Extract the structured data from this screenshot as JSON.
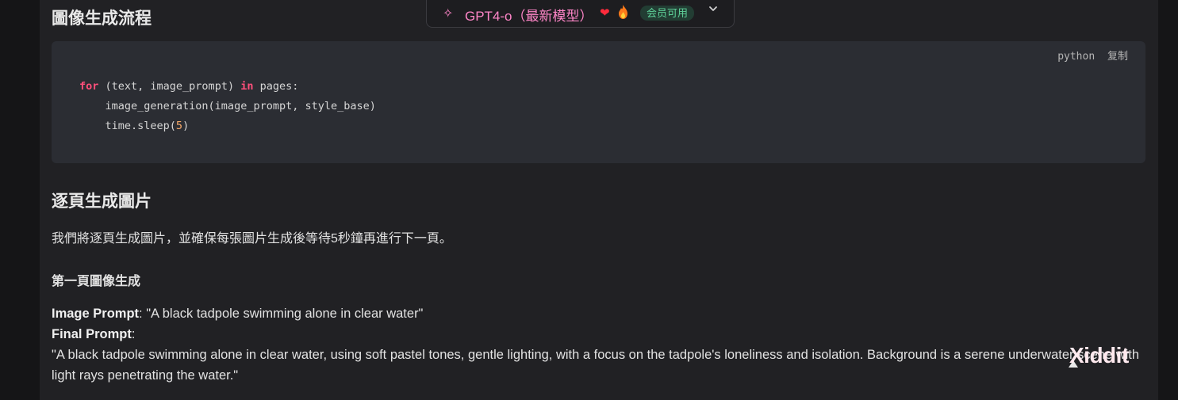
{
  "section_title_flow": "圖像生成流程",
  "code": {
    "language": "python",
    "copy_label": "复制",
    "line1": {
      "kw_for": "for",
      "mid": " (text, image_prompt) ",
      "kw_in": "in",
      "end": " pages:"
    },
    "line2": "    image_generation(image_prompt, style_base)",
    "line3": {
      "pre": "    time.sleep(",
      "num": "5",
      "post": ")"
    }
  },
  "section_title_pages": "逐頁生成圖片",
  "intro_paragraph": "我們將逐頁生成圖片，並確保每張圖片生成後等待5秒鐘再進行下一頁。",
  "page_one_heading": "第一頁圖像生成",
  "image_prompt": {
    "label": "Image Prompt",
    "value": ": \"A black tadpole swimming alone in clear water\""
  },
  "final_prompt": {
    "label": "Final Prompt",
    "colon": ":",
    "value": "\"A black tadpole swimming alone in clear water, using soft pastel tones, gentle lighting, with a focus on the tadpole's loneliness and isolation. Background is a serene underwater scene with light rays penetrating the water.\""
  },
  "model_selector": {
    "icon": "sparkle-icon",
    "name": "GPT4-o（最新模型）",
    "heart": "❤",
    "badge": "会员可用",
    "accent_color": "#ff86c8"
  },
  "watermark": "Xiddit"
}
